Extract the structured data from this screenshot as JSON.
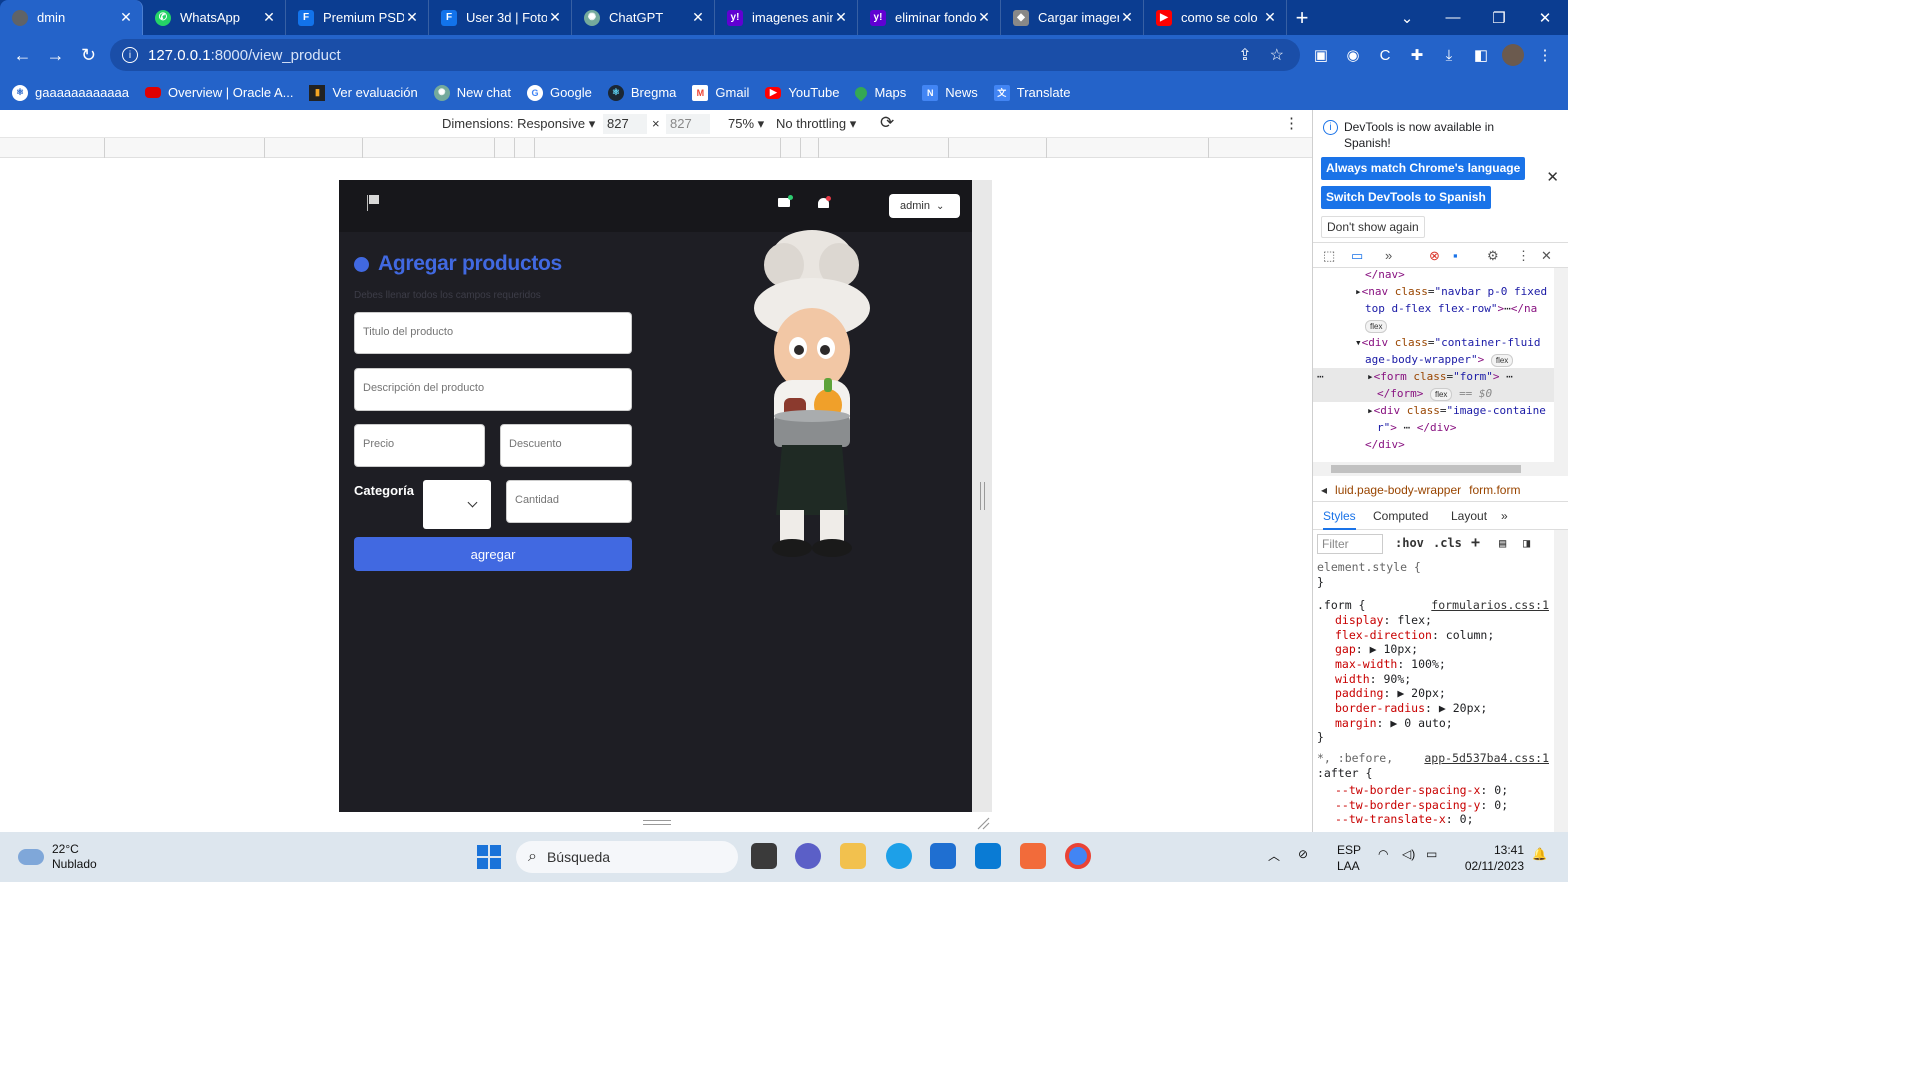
{
  "browser": {
    "tabs": [
      {
        "title": "dmin",
        "icon": "globe-icon",
        "color": "#5f6368",
        "active": true
      },
      {
        "title": "WhatsApp",
        "icon": "whatsapp-icon",
        "color": "#25d366",
        "active": false
      },
      {
        "title": "Premium PSD",
        "icon": "freepik-icon",
        "color": "#1273eb",
        "active": false
      },
      {
        "title": "User 3d | Foto",
        "icon": "freepik-icon",
        "color": "#1273eb",
        "active": false
      },
      {
        "title": "ChatGPT",
        "icon": "chatgpt-icon",
        "color": "#74aa9c",
        "active": false
      },
      {
        "title": "imagenes anim",
        "icon": "yahoo-icon",
        "color": "#6001d2",
        "active": false
      },
      {
        "title": "eliminar fondo",
        "icon": "yahoo-icon",
        "color": "#6001d2",
        "active": false
      },
      {
        "title": "Cargar imagen",
        "icon": "upload-icon",
        "color": "#888888",
        "active": false
      },
      {
        "title": "como se colo",
        "icon": "youtube-icon",
        "color": "#ff0000",
        "active": false
      }
    ],
    "url_host": "127.0.0.1",
    "url_path": ":8000/view_product",
    "bookmarks": [
      {
        "label": "gaaaaaaaaaaaa",
        "icon": "react-icon",
        "color": "#ffffff"
      },
      {
        "label": "Overview | Oracle A...",
        "icon": "oracle-icon",
        "color": "#e00000"
      },
      {
        "label": "Ver evaluación",
        "icon": "chart-icon",
        "color": "#f5a623"
      },
      {
        "label": "New chat",
        "icon": "chatgpt-icon",
        "color": "#74aa9c"
      },
      {
        "label": "Google",
        "icon": "google-icon",
        "color": "#ffffff"
      },
      {
        "label": "Bregma",
        "icon": "react-icon",
        "color": "#61dafb"
      },
      {
        "label": "Gmail",
        "icon": "gmail-icon",
        "color": "#ea4335"
      },
      {
        "label": "YouTube",
        "icon": "youtube-icon",
        "color": "#ff0000"
      },
      {
        "label": "Maps",
        "icon": "maps-icon",
        "color": "#34a853"
      },
      {
        "label": "News",
        "icon": "news-icon",
        "color": "#4285f4"
      },
      {
        "label": "Translate",
        "icon": "translate-icon",
        "color": "#4285f4"
      }
    ]
  },
  "device_toolbar": {
    "dimensions_label": "Dimensions: Responsive",
    "width": "827",
    "height": "827",
    "zoom": "75%",
    "throttling": "No throttling"
  },
  "app": {
    "admin_label": "admin",
    "form_title": "Agregar productos",
    "form_hint": "Debes llenar todos los campos requeridos",
    "title_placeholder": "Titulo del producto",
    "description_placeholder": "Descripción del producto",
    "price_placeholder": "Precio",
    "discount_placeholder": "Descuento",
    "category_label": "Categoría",
    "quantity_placeholder": "Cantidad",
    "submit_label": "agregar"
  },
  "devtools": {
    "banner_text": "DevTools is now available in Spanish!",
    "btn_match": "Always match Chrome's language",
    "btn_switch": "Switch DevTools to Spanish",
    "btn_dont_show": "Don't show again",
    "crumb_1": "luid.page-body-wrapper",
    "crumb_2": "form.form",
    "tab_styles": "Styles",
    "tab_computed": "Computed",
    "tab_layout": "Layout",
    "filter_placeholder": "Filter",
    "hov": ":hov",
    "cls": ".cls",
    "element_style": "element.style {",
    "close_brace": "}",
    "form_selector": ".form {",
    "form_source": "formularios.css:1",
    "form_props": [
      {
        "name": "display",
        "value": "flex;"
      },
      {
        "name": "flex-direction",
        "value": "column;"
      },
      {
        "name": "gap",
        "value": "▶ 10px;"
      },
      {
        "name": "max-width",
        "value": "100%;"
      },
      {
        "name": "width",
        "value": "90%;"
      },
      {
        "name": "padding",
        "value": "▶ 20px;"
      },
      {
        "name": "border-radius",
        "value": "▶ 20px;"
      },
      {
        "name": "margin",
        "value": "▶ 0 auto;"
      }
    ],
    "universal_selector": "*, :before,",
    "universal_selector_2": ":after {",
    "universal_source": "app-5d537ba4.css:1",
    "universal_props": [
      {
        "name": "--tw-border-spacing-x",
        "value": "0;"
      },
      {
        "name": "--tw-border-spacing-y",
        "value": "0;"
      },
      {
        "name": "--tw-translate-x",
        "value": "0;"
      }
    ]
  },
  "taskbar": {
    "temperature": "22°C",
    "weather": "Nublado",
    "search_label": "Búsqueda",
    "lang_1": "ESP",
    "lang_2": "LAA",
    "time": "13:41",
    "date": "02/11/2023"
  }
}
